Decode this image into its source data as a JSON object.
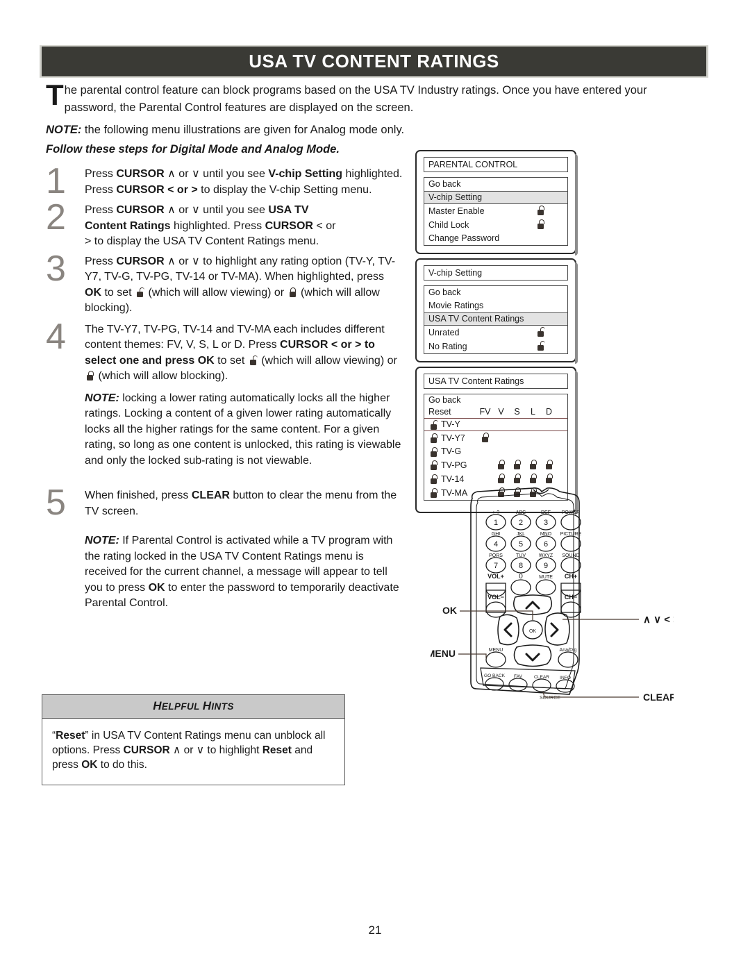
{
  "header": {
    "title": "USA TV CONTENT RATINGS",
    "bar_color": "#3a3a35"
  },
  "intro": {
    "dropcap": "T",
    "text": "he parental control feature can block programs based on the USA TV Industry ratings. Once you have entered your password, the Parental Control features are displayed on the screen."
  },
  "note_analog": {
    "label": "NOTE:",
    "text": " the following menu illustrations are given for Analog mode only."
  },
  "follow_line": "Follow these steps for Digital Mode and Analog Mode.",
  "steps": [
    {
      "number": "1",
      "paragraphs": [
        "Press CURSOR ∧ or ∨ until you see V-chip Setting highlighted. Press CURSOR < or > to display the V-chip Setting menu."
      ]
    },
    {
      "number": "2",
      "paragraphs": [
        "Press CURSOR ∧ or ∨ until you see USA TV Content Ratings highlighted. Press CURSOR < or > to display the USA TV Content Ratings menu."
      ]
    },
    {
      "number": "3",
      "paragraphs": [
        "Press CURSOR ∧ or ∨ to highlight any rating option (TV-Y, TV-Y7, TV-G, TV-PG, TV-14 or TV-MA). When highlighted, press OK to set (which will allow viewing) or (which will allow blocking)."
      ]
    },
    {
      "number": "4",
      "paragraphs": [
        "The TV-Y7, TV-PG, TV-14 and TV-MA each includes different content themes: FV, V, S, L or D. Press CURSOR < or > to select one and press OK to set (which will allow viewing) or (which will allow blocking).",
        "NOTE: locking a lower rating automatically locks all the higher ratings. Locking a content of a given lower rating automatically locks all the higher ratings for the same content. For a given rating, so long as one content is unlocked, this rating is viewable and only the locked sub-rating is not viewable."
      ]
    },
    {
      "number": "5",
      "paragraphs": [
        "When finished, press CLEAR button to clear the menu from the TV screen.",
        "NOTE: If Parental Control is activated while a TV program with the rating locked in the USA TV Content Ratings menu is received for the current channel, a message will appear to tell you to press OK to enter the password to temporarily deactivate Parental Control."
      ]
    }
  ],
  "step_text": {
    "s1_a": "Press ",
    "s1_cursor": "CURSOR",
    "s1_b": " ∧ or ∨ until you see ",
    "s1_vchip": "V-chip Setting",
    "s1_c": " highlighted. Press ",
    "s1_d": " < or > ",
    "s1_e": "to display the V-chip Setting menu.",
    "s2_a": "Press ",
    "s2_b": " ∧ or ∨ until you see ",
    "s2_usatv": "USA TV",
    "s2_cr": "Content Ratings",
    "s2_c": " highlighted. Press ",
    "s2_d": " < or",
    "s2_e": "> to display the USA TV Content Ratings menu.",
    "s3_a": "Press ",
    "s3_b": " ∧ or ∨ to highlight any rating option (TV-Y, TV-Y7, TV-G, TV-PG, TV-14 or TV-MA). When highlighted, press ",
    "s3_ok": "OK",
    "s3_c": " to set ",
    "s3_d": " (which will allow viewing) or ",
    "s3_e": " (which will allow blocking).",
    "s4_a": "The TV-Y7, TV-PG, TV-14 and TV-MA each includes different content themes: FV, V, S, L or D. Press ",
    "s4_b": " < or > to select one and press ",
    "s4_c": " to set ",
    "s4_d": " (which will allow viewing) or ",
    "s4_e": " (which will allow blocking).",
    "s4_note_label": "NOTE:",
    "s4_note": " locking a lower rating automatically locks all the higher ratings. Locking a content of a given lower rating automatically locks all the higher ratings for the same content. For a given rating, so long as one content is unlocked, this rating is viewable and only the locked sub-rating is not viewable.",
    "s5_a": "When finished, press ",
    "s5_clear": "CLEAR",
    "s5_b": " button to clear the menu from the TV screen.",
    "s5_note_label": "NOTE:",
    "s5_note_1": " If Parental Control is activated while a TV program with the rating locked in the USA TV Content Ratings menu is received for the current channel, a message will appear to tell you to press ",
    "s5_note_2": " to enter the password to temporarily deactivate Parental Control."
  },
  "menus": {
    "parental_control": {
      "title": "PARENTAL CONTROL",
      "rows": [
        {
          "label": "Go back",
          "icon": "",
          "highlight": false
        },
        {
          "label": "V-chip Setting",
          "icon": "",
          "highlight": true
        },
        {
          "label": "Master Enable",
          "icon": "lock-closed-icon",
          "highlight": false
        },
        {
          "label": "Child Lock",
          "icon": "lock-closed-icon",
          "highlight": false
        },
        {
          "label": "Change Password",
          "icon": "",
          "highlight": false
        }
      ]
    },
    "vchip_setting": {
      "title": "V-chip Setting",
      "rows": [
        {
          "label": "Go back",
          "icon": "",
          "highlight": false
        },
        {
          "label": "Movie Ratings",
          "icon": "",
          "highlight": false
        },
        {
          "label": "USA TV Content Ratings",
          "icon": "",
          "highlight": true
        },
        {
          "label": "Unrated",
          "icon": "lock-open-icon",
          "highlight": false
        },
        {
          "label": "No Rating",
          "icon": "lock-open-icon",
          "highlight": false
        }
      ]
    },
    "usa_tv_content_ratings": {
      "title": "USA TV Content Ratings",
      "go_back": "Go back",
      "reset": "Reset",
      "columns": [
        "FV",
        "V",
        "S",
        "L",
        "D"
      ],
      "rows": [
        {
          "label": "TV-Y",
          "state": "unlocked",
          "selected": true,
          "locks": [
            false,
            false,
            false,
            false,
            false
          ]
        },
        {
          "label": "TV-Y7",
          "state": "locked",
          "selected": false,
          "locks": [
            true,
            false,
            false,
            false,
            false
          ]
        },
        {
          "label": "TV-G",
          "state": "locked",
          "selected": false,
          "locks": [
            false,
            false,
            false,
            false,
            false
          ]
        },
        {
          "label": "TV-PG",
          "state": "locked",
          "selected": false,
          "locks": [
            false,
            true,
            true,
            true,
            true
          ]
        },
        {
          "label": "TV-14",
          "state": "locked",
          "selected": false,
          "locks": [
            false,
            true,
            true,
            true,
            true
          ]
        },
        {
          "label": "TV-MA",
          "state": "locked",
          "selected": false,
          "locks": [
            false,
            true,
            true,
            true,
            false
          ]
        }
      ]
    }
  },
  "remote": {
    "keys": [
      {
        "sub": "+-?",
        "main": "1"
      },
      {
        "sub": "ABC",
        "main": "2"
      },
      {
        "sub": "DEF",
        "main": "3"
      },
      {
        "sub": "POWER",
        "main": ""
      },
      {
        "sub": "GHI",
        "main": "4"
      },
      {
        "sub": "JKL",
        "main": "5"
      },
      {
        "sub": "MNO",
        "main": "6"
      },
      {
        "sub": "PICTURE",
        "main": ""
      },
      {
        "sub": "PQRS",
        "main": "7"
      },
      {
        "sub": "TUV",
        "main": "8"
      },
      {
        "sub": "WXYZ",
        "main": "9"
      },
      {
        "sub": "SOUND",
        "main": ""
      }
    ],
    "vol_plus": "VOL+",
    "vol_minus": "VOL−",
    "zero": "0",
    "mute": "MUTE",
    "ch_plus": "CH+",
    "ch_minus": "CH−",
    "menu_key": "MENU",
    "anadig": "Ana/Dig",
    "ok_key": "OK",
    "bottom_keys": [
      "GO BACK",
      "FAV",
      "CLEAR",
      "INFO"
    ],
    "source": "SOURCE",
    "callouts": {
      "ok": "OK",
      "menu": "MENU",
      "cursor": "∧  ∨  <  >",
      "clear": "CLEAR"
    }
  },
  "hints": {
    "title_big_h": "H",
    "title_rest_1": "ELPFUL ",
    "title_big_h2": "H",
    "title_rest_2": "INTS",
    "title_full": "HELPFUL HINTS",
    "quote_open": "“",
    "reset": "Reset",
    "quote_close": "”",
    "body_a": " in  USA TV Content Ratings menu can unblock all options. Press ",
    "cursor": "CURSOR",
    "body_b": " ∧ or ∨ to highlight ",
    "body_c": " and press ",
    "ok": "OK",
    "body_d": " to do this."
  },
  "page_number": "21"
}
